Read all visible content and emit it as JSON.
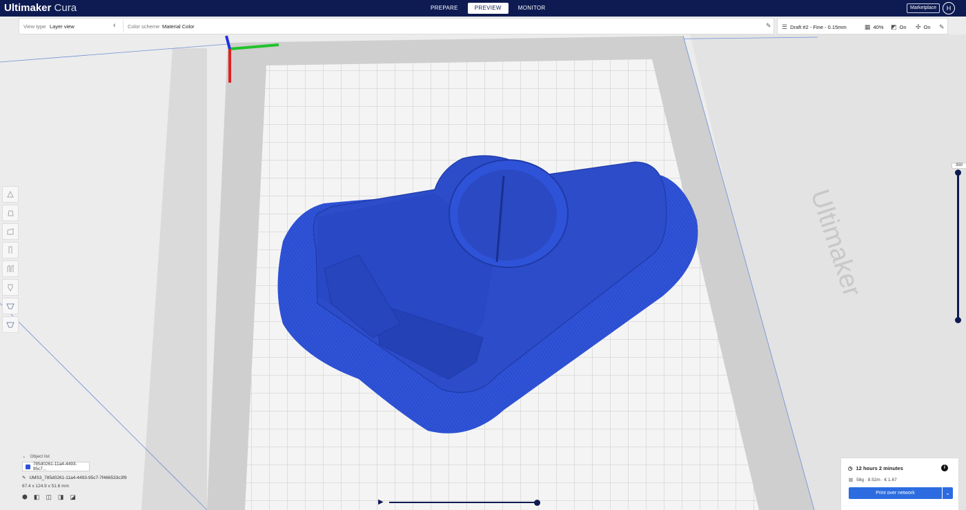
{
  "app": {
    "name_bold": "Ultimaker",
    "name_light": "Cura"
  },
  "stages": [
    "PREPARE",
    "PREVIEW",
    "MONITOR"
  ],
  "active_stage": "PREVIEW",
  "header": {
    "marketplace_label": "Marketplace",
    "user_initial": "H"
  },
  "view_toolbar": {
    "view_type_label": "View type",
    "view_type_value": "Layer view",
    "color_scheme_label": "Color scheme",
    "color_scheme_value": "Material Color"
  },
  "print_setup": {
    "profile": "Draft #2 - Fine - 0.15mm",
    "infill": "40%",
    "support": "On",
    "adhesion": "On"
  },
  "layer_slider": {
    "max_label": "350",
    "upper_fraction": 1.0,
    "lower_fraction": 0.0
  },
  "object_list": {
    "header": "Object list",
    "item_name": "785d0261-11a4-4493-95c7...",
    "file_name": "UMS3_785d0261-11a4-4493-95c7-7f466533c3f9",
    "dimensions": "67.4 x 124.9 x 51.6 mm"
  },
  "playback": {
    "progress_fraction": 1.0
  },
  "print_info": {
    "time": "12 hours 2 minutes",
    "material": "58g · 8.52m · € 1.67",
    "button_label": "Print over network"
  },
  "bed_brand": "Ultimaker",
  "colors": {
    "header": "#0e1b52",
    "model": "#2f53d8",
    "button": "#2c6ce0"
  }
}
